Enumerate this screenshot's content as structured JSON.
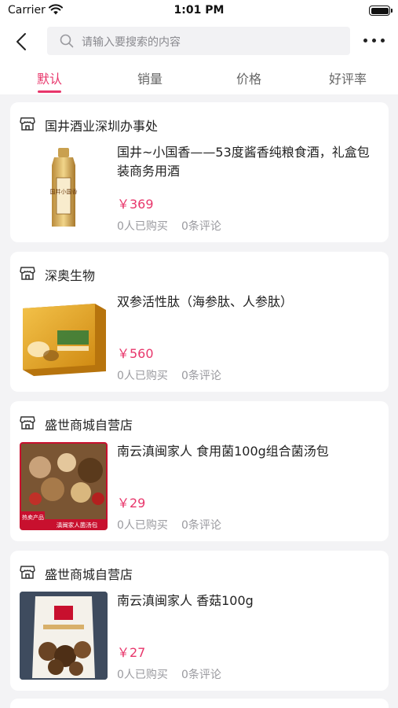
{
  "status_bar": {
    "carrier": "Carrier",
    "time": "1:01 PM"
  },
  "search": {
    "placeholder": "请输入要搜索的内容"
  },
  "tabs": [
    {
      "label": "默认",
      "active": true
    },
    {
      "label": "销量",
      "active": false
    },
    {
      "label": "价格",
      "active": false
    },
    {
      "label": "好评率",
      "active": false
    }
  ],
  "products": [
    {
      "store": "国井酒业深圳办事处",
      "title": "国井~小国香——53度酱香纯粮食酒，礼盒包装商务用酒",
      "price": "￥369",
      "bought": "0人已购买",
      "reviews": "0条评论",
      "image_label": "国井小国香"
    },
    {
      "store": "深奥生物",
      "title": "双参活性肽（海参肽、人参肽）",
      "price": "￥560",
      "bought": "0人已购买",
      "reviews": "0条评论"
    },
    {
      "store": "盛世商城自营店",
      "title": "南云滇闽家人 食用菌100g组合菌汤包",
      "price": "￥29",
      "bought": "0人已购买",
      "reviews": "0条评论",
      "badge_hot": "热卖产品",
      "badge_name": "滇闽家人菌汤包"
    },
    {
      "store": "盛世商城自营店",
      "title": "南云滇闽家人 香菇100g",
      "price": "￥27",
      "bought": "0人已购买",
      "reviews": "0条评论"
    }
  ],
  "colors": {
    "accent": "#e8366b",
    "background": "#f3f3f5",
    "muted_text": "#9a9a9f"
  },
  "icons": [
    "wifi-icon",
    "battery-icon",
    "back-arrow-icon",
    "search-icon",
    "more-icon",
    "store-icon"
  ]
}
